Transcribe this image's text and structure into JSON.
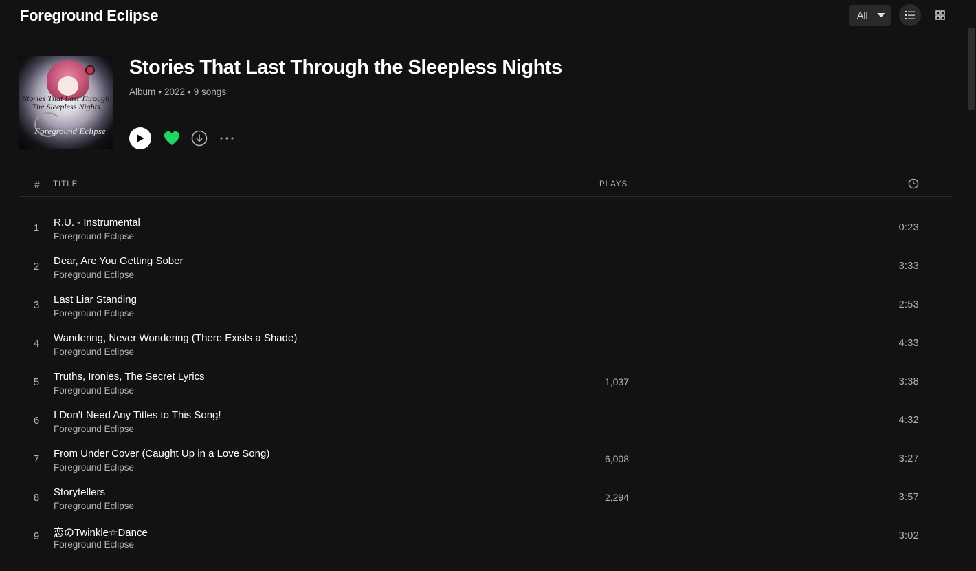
{
  "header": {
    "artist_title": "Foreground Eclipse",
    "filter_label": "All"
  },
  "album": {
    "art_text_line1": "Stories That Last Through",
    "art_text_line2": "The Sleepless Nights",
    "art_text_line3": "Foreground Eclipse",
    "name": "Stories That Last Through the Sleepless Nights",
    "type": "Album",
    "year": "2022",
    "song_count": "9 songs",
    "separator": "•"
  },
  "colors": {
    "background": "#121212",
    "accent": "#1ed760",
    "text_primary": "#ffffff",
    "text_secondary": "#b3b3b3"
  },
  "icons": {
    "play": "play-icon",
    "heart": "heart-filled-icon",
    "download": "download-icon",
    "more": "more-horizontal-icon",
    "list_view": "list-view-icon",
    "grid_view": "grid-view-icon",
    "duration": "clock-icon",
    "dropdown": "caret-down-icon"
  },
  "table": {
    "col_num": "#",
    "col_title": "TITLE",
    "col_plays": "PLAYS"
  },
  "tracks": [
    {
      "num": "1",
      "title": "R.U. - Instrumental",
      "artist": "Foreground Eclipse",
      "plays": "",
      "duration": "0:23"
    },
    {
      "num": "2",
      "title": "Dear, Are You Getting Sober",
      "artist": "Foreground Eclipse",
      "plays": "",
      "duration": "3:33"
    },
    {
      "num": "3",
      "title": "Last Liar Standing",
      "artist": "Foreground Eclipse",
      "plays": "",
      "duration": "2:53"
    },
    {
      "num": "4",
      "title": "Wandering, Never Wondering (There Exists a Shade)",
      "artist": "Foreground Eclipse",
      "plays": "",
      "duration": "4:33"
    },
    {
      "num": "5",
      "title": "Truths, Ironies, The Secret Lyrics",
      "artist": "Foreground Eclipse",
      "plays": "1,037",
      "duration": "3:38"
    },
    {
      "num": "6",
      "title": "I Don't Need Any Titles to This Song!",
      "artist": "Foreground Eclipse",
      "plays": "",
      "duration": "4:32"
    },
    {
      "num": "7",
      "title": "From Under Cover (Caught Up in a Love Song)",
      "artist": "Foreground Eclipse",
      "plays": "6,008",
      "duration": "3:27"
    },
    {
      "num": "8",
      "title": "Storytellers",
      "artist": "Foreground Eclipse",
      "plays": "2,294",
      "duration": "3:57"
    },
    {
      "num": "9",
      "title": "恋のTwinkle☆Dance",
      "artist": "Foreground Eclipse",
      "plays": "",
      "duration": "3:02"
    }
  ]
}
